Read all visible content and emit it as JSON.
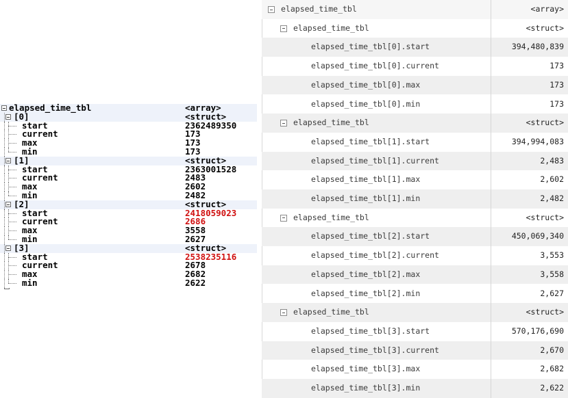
{
  "left_tree": {
    "root": {
      "name": "elapsed_time_tbl",
      "type": "<array>"
    },
    "elements": [
      {
        "label": "[0]",
        "type": "<struct>",
        "fields": [
          {
            "name": "start",
            "value": "2362489350",
            "highlight": false
          },
          {
            "name": "current",
            "value": "173",
            "highlight": false
          },
          {
            "name": "max",
            "value": "173",
            "highlight": false
          },
          {
            "name": "min",
            "value": "173",
            "highlight": false
          }
        ]
      },
      {
        "label": "[1]",
        "type": "<struct>",
        "fields": [
          {
            "name": "start",
            "value": "2363001528",
            "highlight": false
          },
          {
            "name": "current",
            "value": "2483",
            "highlight": false
          },
          {
            "name": "max",
            "value": "2602",
            "highlight": false
          },
          {
            "name": "min",
            "value": "2482",
            "highlight": false
          }
        ]
      },
      {
        "label": "[2]",
        "type": "<struct>",
        "fields": [
          {
            "name": "start",
            "value": "2418059023",
            "highlight": true
          },
          {
            "name": "current",
            "value": "2686",
            "highlight": true
          },
          {
            "name": "max",
            "value": "3558",
            "highlight": false
          },
          {
            "name": "min",
            "value": "2627",
            "highlight": false
          }
        ]
      },
      {
        "label": "[3]",
        "type": "<struct>",
        "fields": [
          {
            "name": "start",
            "value": "2538235116",
            "highlight": true
          },
          {
            "name": "current",
            "value": "2678",
            "highlight": false
          },
          {
            "name": "max",
            "value": "2682",
            "highlight": false
          },
          {
            "name": "min",
            "value": "2622",
            "highlight": false
          }
        ]
      }
    ],
    "highlight_color": "#d01010"
  },
  "right_table": {
    "root": {
      "name": "elapsed_time_tbl",
      "value": "<array>"
    },
    "groups": [
      {
        "name": "elapsed_time_tbl",
        "value": "<struct>",
        "rows": [
          {
            "name": "elapsed_time_tbl[0].start",
            "value": "394,480,839"
          },
          {
            "name": "elapsed_time_tbl[0].current",
            "value": "173"
          },
          {
            "name": "elapsed_time_tbl[0].max",
            "value": "173"
          },
          {
            "name": "elapsed_time_tbl[0].min",
            "value": "173"
          }
        ]
      },
      {
        "name": "elapsed_time_tbl",
        "value": "<struct>",
        "rows": [
          {
            "name": "elapsed_time_tbl[1].start",
            "value": "394,994,083"
          },
          {
            "name": "elapsed_time_tbl[1].current",
            "value": "2,483"
          },
          {
            "name": "elapsed_time_tbl[1].max",
            "value": "2,602"
          },
          {
            "name": "elapsed_time_tbl[1].min",
            "value": "2,482"
          }
        ]
      },
      {
        "name": "elapsed_time_tbl",
        "value": "<struct>",
        "rows": [
          {
            "name": "elapsed_time_tbl[2].start",
            "value": "450,069,340"
          },
          {
            "name": "elapsed_time_tbl[2].current",
            "value": "3,553"
          },
          {
            "name": "elapsed_time_tbl[2].max",
            "value": "3,558"
          },
          {
            "name": "elapsed_time_tbl[2].min",
            "value": "2,627"
          }
        ]
      },
      {
        "name": "elapsed_time_tbl",
        "value": "<struct>",
        "rows": [
          {
            "name": "elapsed_time_tbl[3].start",
            "value": "570,176,690"
          },
          {
            "name": "elapsed_time_tbl[3].current",
            "value": "2,670"
          },
          {
            "name": "elapsed_time_tbl[3].max",
            "value": "2,682"
          },
          {
            "name": "elapsed_time_tbl[3].min",
            "value": "2,622"
          }
        ]
      }
    ]
  }
}
